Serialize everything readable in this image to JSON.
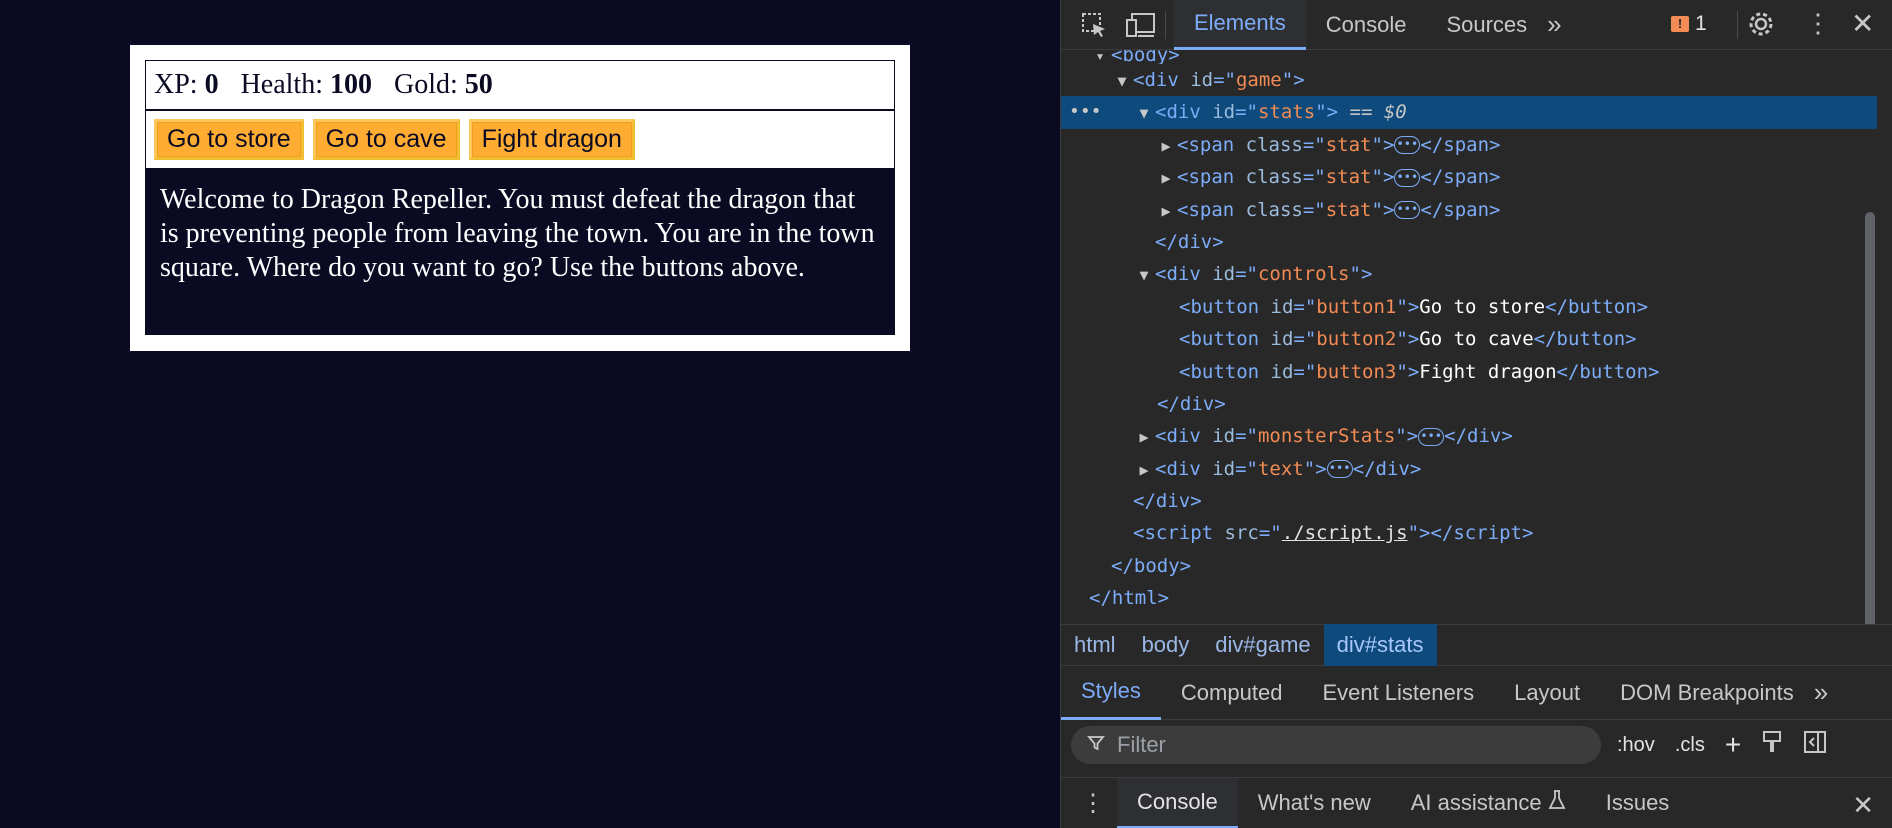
{
  "game": {
    "stats": [
      {
        "label": "XP:",
        "value": "0"
      },
      {
        "label": "Health:",
        "value": "100"
      },
      {
        "label": "Gold:",
        "value": "50"
      }
    ],
    "buttons": [
      "Go to store",
      "Go to cave",
      "Fight dragon"
    ],
    "text": "Welcome to Dragon Repeller. You must defeat the dragon that is preventing people from leaving the town. You are in the town square. Where do you want to go? Use the buttons above."
  },
  "devtools": {
    "tabs": [
      "Elements",
      "Console",
      "Sources"
    ],
    "issue_count": "1",
    "dom": {
      "body_open": "<body>",
      "game_id": "game",
      "stats_id": "stats",
      "stats_suffix": "== $0",
      "span_class": "stat",
      "controls_id": "controls",
      "buttons": [
        {
          "id": "button1",
          "text": "Go to store"
        },
        {
          "id": "button2",
          "text": "Go to cave"
        },
        {
          "id": "button3",
          "text": "Fight dragon"
        }
      ],
      "monster_id": "monsterStats",
      "text_id": "text",
      "script_src": "./script.js"
    },
    "breadcrumbs": [
      "html",
      "body",
      "div#game",
      "div#stats"
    ],
    "subtabs": [
      "Styles",
      "Computed",
      "Event Listeners",
      "Layout",
      "DOM Breakpoints"
    ],
    "filter_placeholder": "Filter",
    "hov": ":hov",
    "cls": ".cls",
    "drawer_tabs": [
      "Console",
      "What's new",
      "AI assistance",
      "Issues"
    ],
    "colors": {
      "selected_row": "#0e4a7c",
      "accent": "#7cacf8",
      "game_button": "#feac32",
      "page_bg": "#0a0a23"
    }
  }
}
